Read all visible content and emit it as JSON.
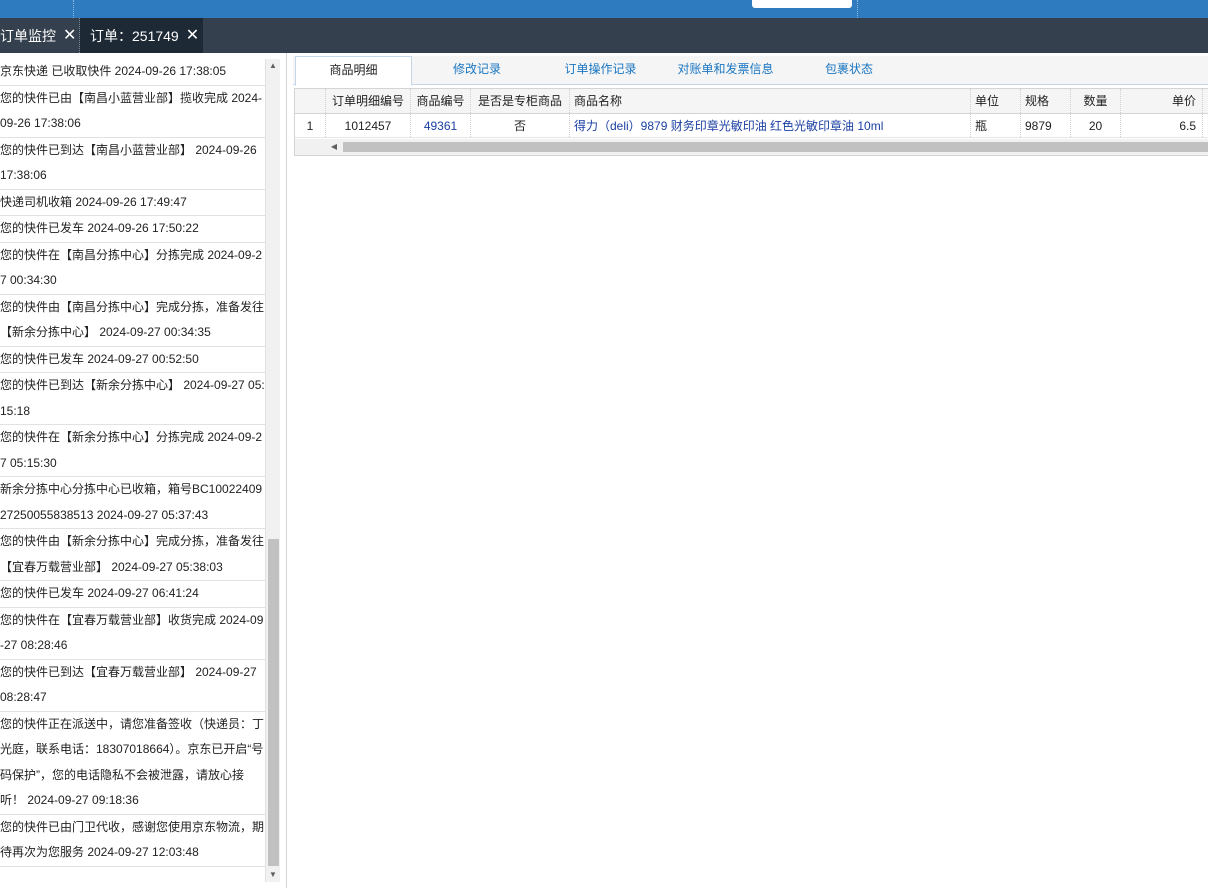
{
  "tabs": [
    {
      "label": "订单监控",
      "close": "✕"
    },
    {
      "label": "订单：251749",
      "close": "✕"
    }
  ],
  "tracking": [
    "京东快递 已收取快件 2024-09-26 17:38:05",
    "您的快件已由【南昌小蓝营业部】揽收完成 2024-09-26 17:38:06",
    "您的快件已到达【南昌小蓝营业部】 2024-09-26 17:38:06",
    "快递司机收箱 2024-09-26 17:49:47",
    "您的快件已发车 2024-09-26 17:50:22",
    "您的快件在【南昌分拣中心】分拣完成 2024-09-27 00:34:30",
    "您的快件由【南昌分拣中心】完成分拣，准备发往【新余分拣中心】 2024-09-27 00:34:35",
    "您的快件已发车 2024-09-27 00:52:50",
    "您的快件已到达【新余分拣中心】 2024-09-27 05:15:18",
    "您的快件在【新余分拣中心】分拣完成 2024-09-27 05:15:30",
    "新余分拣中心分拣中心已收箱，箱号BC1002240927250055838513 2024-09-27 05:37:43",
    "您的快件由【新余分拣中心】完成分拣，准备发往【宜春万载营业部】 2024-09-27 05:38:03",
    "您的快件已发车 2024-09-27 06:41:24",
    "您的快件在【宜春万载营业部】收货完成 2024-09-27 08:28:46",
    "您的快件已到达【宜春万载营业部】 2024-09-27 08:28:47",
    "您的快件正在派送中，请您准备签收（快递员：丁光庭，联系电话：18307018664）。京东已开启“号码保护”，您的电话隐私不会被泄露，请放心接听！ 2024-09-27 09:18:36",
    "您的快件已由门卫代收，感谢您使用京东物流，期待再次为您服务 2024-09-27 12:03:48"
  ],
  "subtabs": [
    "商品明细",
    "修改记录",
    "订单操作记录",
    "对账单和发票信息",
    "包裹状态"
  ],
  "grid": {
    "headers": [
      "订单明细编号",
      "商品编号",
      "是否是专柜商品",
      "商品名称",
      "单位",
      "规格",
      "数量",
      "单价"
    ],
    "rows": [
      {
        "index": "1",
        "detail_id": "1012457",
        "product_id": "49361",
        "is_counter": "否",
        "name": "得力（deli）9879 财务印章光敏印油 红色光敏印章油 10ml",
        "unit": "瓶",
        "spec": "9879",
        "qty": "20",
        "price": "6.5"
      }
    ]
  },
  "icons": {
    "close": "close-icon",
    "scroll_up": "arrow-up-icon",
    "scroll_down": "arrow-down-icon",
    "scroll_left": "arrow-left-icon"
  },
  "colors": {
    "topbar": "#2f7bc0",
    "tabstrip": "#34404d",
    "link": "#1a3fa3",
    "subtab_link": "#1a76c2"
  }
}
